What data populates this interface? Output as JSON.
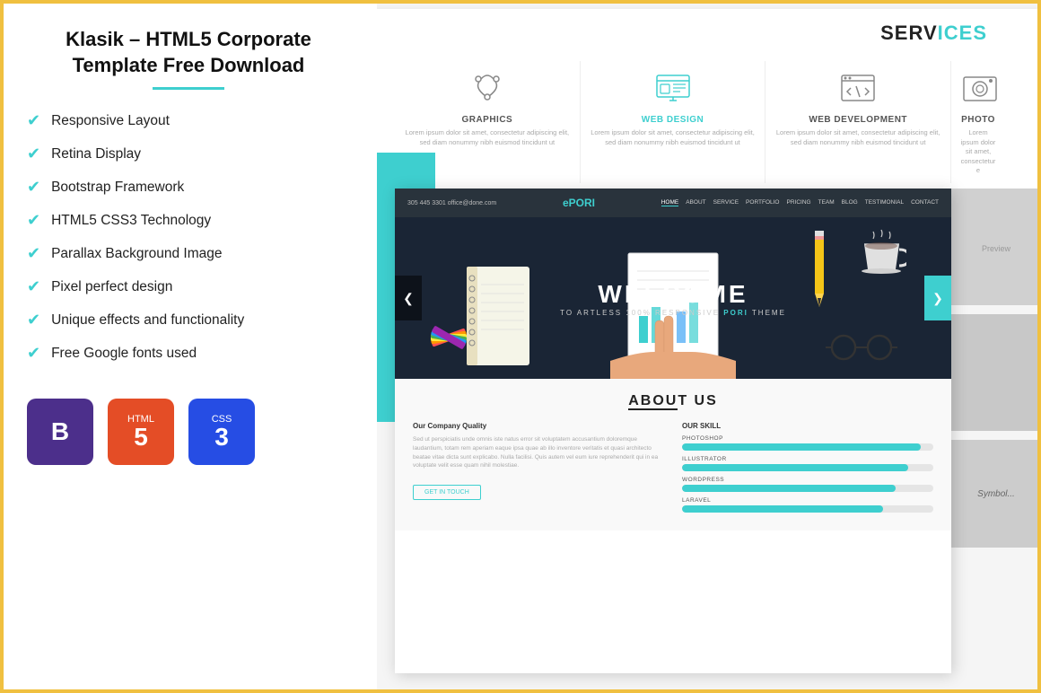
{
  "title": "Klasik – HTML5 Corporate Template Free Download",
  "title_underline_color": "#3ecfcf",
  "features": [
    "Responsive Layout",
    "Retina Display",
    "Bootstrap Framework",
    "HTML5 CSS3 Technology",
    "Parallax Background Image",
    "Pixel perfect design",
    "Unique effects and functionality",
    "Free Google fonts used"
  ],
  "tech_logos": [
    {
      "name": "Bootstrap",
      "symbol": "B",
      "type": "bootstrap"
    },
    {
      "name": "HTML5",
      "type": "html"
    },
    {
      "name": "CSS3",
      "type": "css"
    }
  ],
  "services_title": "SERV",
  "services_title_accent": "ICES",
  "services": [
    {
      "name": "GRAPHICS",
      "active": false
    },
    {
      "name": "WEB DESIGN",
      "active": true
    },
    {
      "name": "WEB DEVELOPMENT",
      "active": false
    },
    {
      "name": "PHOTO",
      "active": false
    }
  ],
  "preview": {
    "nav_contact": "305 445 3301  office@done.com",
    "logo": "ePORI",
    "nav_links": [
      "HOME",
      "ABOUT",
      "SERVICE",
      "PORTFOLIO",
      "PRICING",
      "TEAM",
      "BLOG",
      "TESTIMONIAL",
      "CONTACT"
    ],
    "hero_welcome": "WELCOME",
    "hero_subtitle": "TO ARTLESS 100% RESPONSIVE",
    "hero_subtitle_brand": "PORI",
    "hero_subtitle_end": "THEME",
    "about_title": "ABOUT US",
    "about_company_title": "Our Company Quality",
    "about_company_text": "Sed ut perspiciatis unde omnis iste natus error sit voluptatem accusantium doloremque laudantium, totam rem aperiam eaque ipsa quae ab illo inventore veritatis et quasi architecto beatae vitae dicta sunt explicabo. Nulla facilisi. Quis autem vel eum iure reprehenderit qui in ea voluptate velit esse quam nihil molestiae.",
    "skills_title": "OUR SKILL",
    "skills": [
      {
        "name": "PHOTOSHOP",
        "pct": 95
      },
      {
        "name": "ILLUSTRATOR",
        "pct": 90
      },
      {
        "name": "WORDPRESS",
        "pct": 85
      },
      {
        "name": "LARAVEL",
        "pct": 80
      }
    ],
    "get_in_touch": "GET IN TOUCH"
  },
  "colors": {
    "accent": "#3ecfcf",
    "dark": "#1a2535",
    "border": "#f0c040"
  }
}
